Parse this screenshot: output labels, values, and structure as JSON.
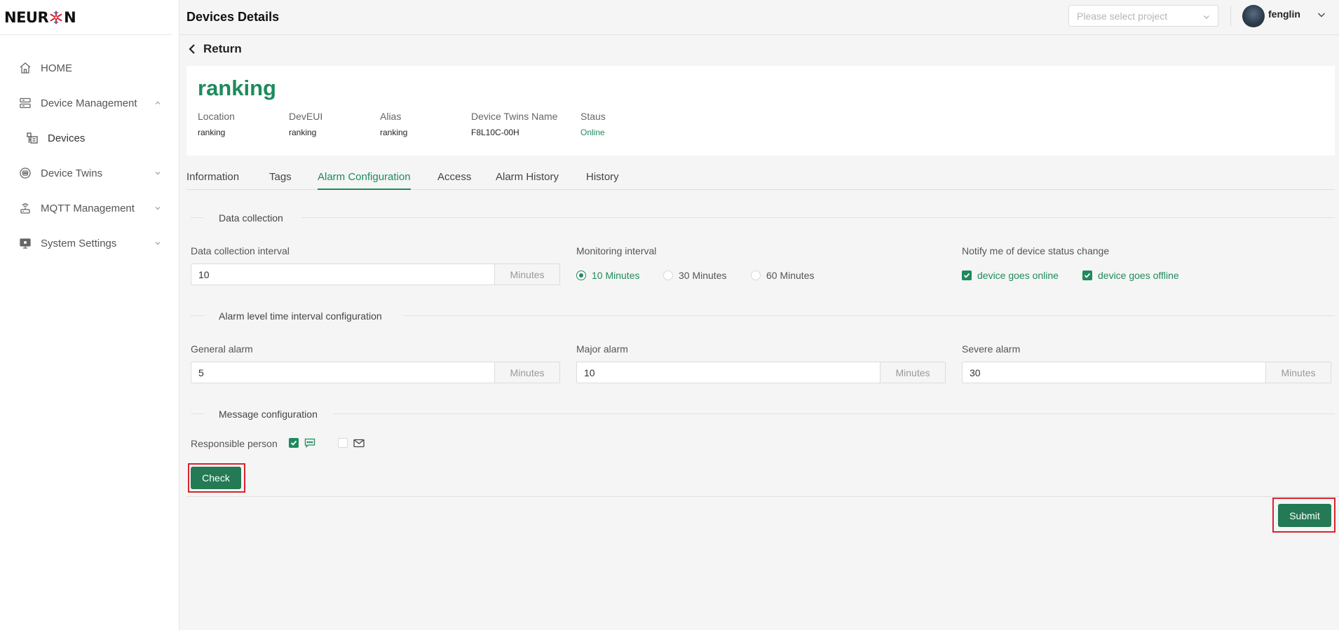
{
  "brand": {
    "logo_text_left": "NEUR",
    "logo_text_right": "N"
  },
  "sidebar": {
    "items": [
      {
        "label": "HOME",
        "icon": "home-icon",
        "expandable": false
      },
      {
        "label": "Device Management",
        "icon": "server-icon",
        "expandable": true,
        "expanded": true
      },
      {
        "label": "Devices",
        "icon": "devices-icon",
        "expandable": false,
        "sub": true
      },
      {
        "label": "Device Twins",
        "icon": "twins-icon",
        "expandable": true,
        "expanded": false
      },
      {
        "label": "MQTT Management",
        "icon": "mqtt-icon",
        "expandable": true,
        "expanded": false
      },
      {
        "label": "System Settings",
        "icon": "monitor-icon",
        "expandable": true,
        "expanded": false
      }
    ]
  },
  "header": {
    "title": "Devices Details",
    "project_placeholder": "Please select project",
    "username": "fenglin"
  },
  "return_label": "Return",
  "device": {
    "name": "ranking",
    "meta": [
      {
        "key": "Location",
        "value": "ranking"
      },
      {
        "key": "DevEUI",
        "value": "ranking"
      },
      {
        "key": "Alias",
        "value": "ranking"
      },
      {
        "key": "Device Twins Name",
        "value": "F8L10C-00H"
      },
      {
        "key": "Staus",
        "value": "Online"
      }
    ]
  },
  "tabs": [
    "Information",
    "Tags",
    "Alarm Configuration",
    "Access",
    "Alarm History",
    "History"
  ],
  "active_tab": "Alarm Configuration",
  "data_collection": {
    "section_title": "Data collection",
    "interval_label": "Data collection interval",
    "interval_value": "10",
    "interval_unit": "Minutes",
    "monitoring_label": "Monitoring interval",
    "monitoring_options": [
      "10 Minutes",
      "30 Minutes",
      "60 Minutes"
    ],
    "monitoring_selected": "10 Minutes",
    "notify_label": "Notify me of device status change",
    "notify_online": "device goes online",
    "notify_offline": "device goes offline"
  },
  "alarm_levels": {
    "section_title": "Alarm level time interval configuration",
    "general_label": "General alarm",
    "general_value": "5",
    "major_label": "Major alarm",
    "major_value": "10",
    "severe_label": "Severe alarm",
    "severe_value": "30",
    "unit": "Minutes"
  },
  "message": {
    "section_title": "Message configuration",
    "responsible_label": "Responsible person",
    "sms_checked": true,
    "email_checked": false
  },
  "buttons": {
    "check": "Check",
    "submit": "Submit"
  },
  "colors": {
    "accent": "#1f8a5d",
    "button": "#237a55",
    "highlight": "#d9232c"
  }
}
